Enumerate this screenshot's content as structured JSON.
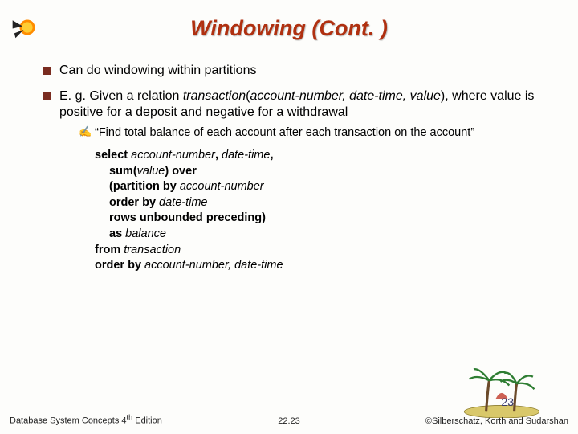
{
  "title": "Windowing (Cont. )",
  "bullets": {
    "b1": "Can do windowing within partitions",
    "b2_pre": "E. g. Given a relation ",
    "b2_rel": "transaction",
    "b2_open": "(",
    "b2_args": "account-number, date-time, value",
    "b2_close": ")",
    "b2_tail": ", where value is positive for a deposit and negative for a withdrawal"
  },
  "sub1": "“Find total balance of each account after each transaction on the account”",
  "code": {
    "l1a": "select ",
    "l1b": "account-number",
    "l1c": ", ",
    "l1d": "date-time",
    "l1e": ",",
    "l2a": "sum",
    "l2b": "(",
    "l2c": "value",
    "l2d": ") ",
    "l2e": "over",
    "l3a": "(",
    "l3b": "partition by ",
    "l3c": "account-number",
    "l4a": "order by ",
    "l4b": "date-time",
    "l5a": "rows unbounded preceding",
    "l5b": ")",
    "l6a": "as ",
    "l6b": "balance",
    "l7a": "from ",
    "l7b": "transaction",
    "l8a": "order by ",
    "l8b": "account-number, date-time"
  },
  "footer": {
    "left_a": "Database System Concepts 4",
    "left_sup": "th",
    "left_b": " Edition",
    "center": "22.23",
    "right": "©Silberschatz, Korth and Sudarshan"
  },
  "page_badge": "23"
}
